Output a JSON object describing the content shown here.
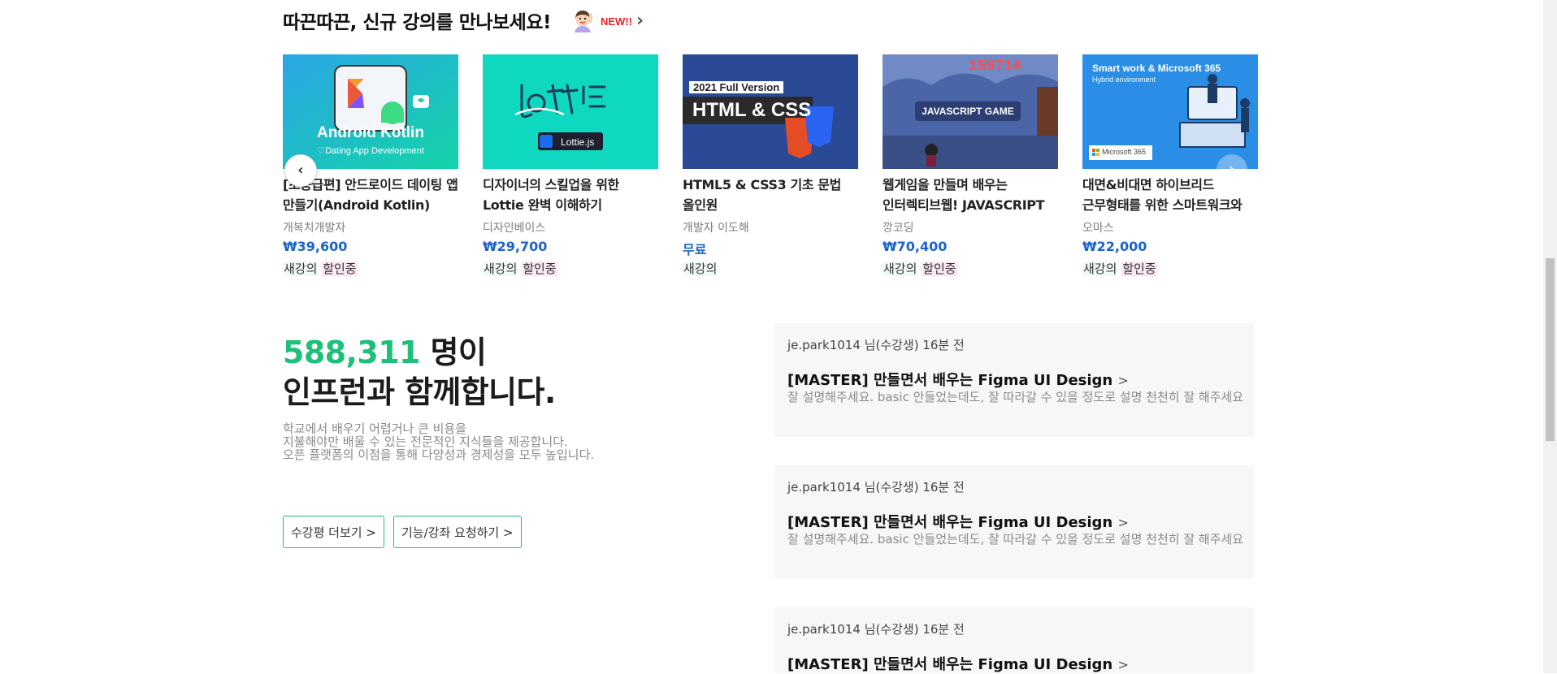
{
  "section": {
    "title": "따끈따끈, 신규 강의를 만나보세요!",
    "emoji_icon": "raising-hand-person-icon",
    "new_badge": "NEW!!",
    "arrow": "›"
  },
  "carousel": {
    "prev_icon": "chevron-left-icon",
    "prev_glyph": "‹",
    "next_icon": "chevron-right-icon",
    "next_glyph": "›"
  },
  "courses": [
    {
      "thumb_title": "Android Kotlin",
      "thumb_sub": "♡Dating App Development",
      "title": "[초중급편] 안드로이드 데이팅 앱 만들기(Android Kotlin)",
      "instructor": "개복치개발자",
      "price": "₩39,600",
      "tag_new": "새강의",
      "tag_sale": "할인중",
      "thumb_color": "#1fc6ad"
    },
    {
      "thumb_title": "LOTTIE",
      "thumb_sub": "Lottie.js",
      "title": "디자이너의 스킬업을 위한 Lottie 완벽 이해하기",
      "instructor": "디자인베이스",
      "price": "₩29,700",
      "tag_new": "새강의",
      "tag_sale": "할인중",
      "thumb_color": "#0fd8c0"
    },
    {
      "thumb_title": "HTML & CSS",
      "thumb_sub": "2021 Full Version",
      "title": "HTML5 & CSS3 기초 문법 올인원",
      "instructor": "개발자 이도해",
      "price": "무료",
      "tag_new": "새강의",
      "tag_sale": "",
      "thumb_color": "#2b4a96"
    },
    {
      "thumb_title": "JAVASCRIPT GAME",
      "thumb_sub": "159714",
      "title": "웹게임을 만들며 배우는 인터렉티브웹! JAVASCRIPT",
      "instructor": "깡코딩",
      "price": "₩70,400",
      "tag_new": "새강의",
      "tag_sale": "할인중",
      "thumb_color": "#4a66a8"
    },
    {
      "thumb_title": "Smart work & Microsoft 365",
      "thumb_sub": "Hybrid environment",
      "thumb_badge": "Microsoft 365",
      "title": "대면&비대면 하이브리드 근무형태를 위한 스마트워크와",
      "instructor": "오마스",
      "price": "₩22,000",
      "tag_new": "새강의",
      "tag_sale": "할인중",
      "thumb_color": "#2b8ee6"
    }
  ],
  "stats": {
    "count": "588,311",
    "count_suffix": " 명이",
    "line2": "인프런과 함께합니다.",
    "desc1": "학교에서 배우기 어렵거나 큰 비용을",
    "desc2": "지불해야만 배울 수 있는 전문적인 지식들을 제공합니다.",
    "desc3": "오픈 플랫폼의 이점을 통해 다양성과 경제성을 모두 높입니다.",
    "btn_reviews": "수강평 더보기 >",
    "btn_request": "기능/강좌 요청하기 >"
  },
  "reviews": [
    {
      "meta": "je.park1014 님(수강생) 16분 전",
      "title": "[MASTER] 만들면서 배우는 Figma UI Design",
      "gt": ">",
      "body": "잘 설명해주세요. basic 안들었는데도, 잘 따라갈 수 있을 정도로 설명 천천히 잘 해주세요"
    },
    {
      "meta": "je.park1014 님(수강생) 16분 전",
      "title": "[MASTER] 만들면서 배우는 Figma UI Design",
      "gt": ">",
      "body": "잘 설명해주세요. basic 안들었는데도, 잘 따라갈 수 있을 정도로 설명 천천히 잘 해주세요"
    },
    {
      "meta": "je.park1014 님(수강생) 16분 전",
      "title": "[MASTER] 만들면서 배우는 Figma UI Design",
      "gt": ">",
      "body": ""
    }
  ]
}
